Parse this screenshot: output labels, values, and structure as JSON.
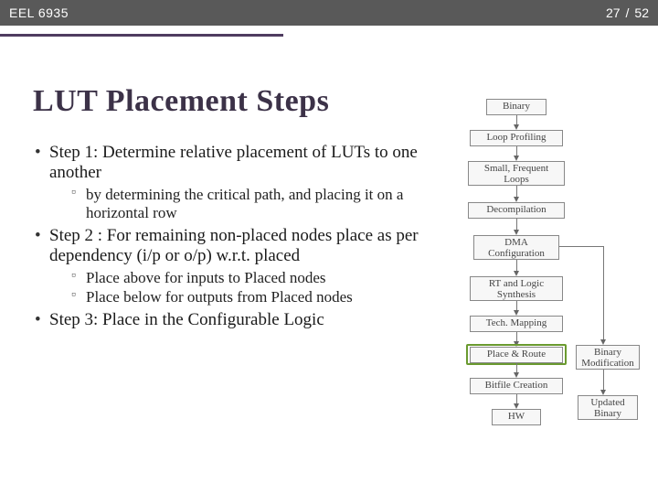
{
  "header": {
    "course": "EEL 6935",
    "page_current": "27",
    "page_sep": "/",
    "page_total": "52"
  },
  "title": "LUT Placement Steps",
  "bullets": [
    {
      "text": "Step 1: Determine relative placement of LUTs to one another",
      "sub": [
        "by determining the critical path, and placing it on a horizontal row"
      ]
    },
    {
      "text": "Step 2 : For remaining non-placed nodes place as per dependency (i/p or o/p) w.r.t. placed",
      "sub": [
        "Place  above for inputs to Placed nodes",
        "Place below for outputs from Placed nodes"
      ]
    },
    {
      "text": "Step 3: Place in the Configurable Logic",
      "sub": []
    }
  ],
  "flow": {
    "n1": "Binary",
    "n2": "Loop Profiling",
    "n3": "Small, Frequent Loops",
    "n4": "Decompilation",
    "n5": "DMA Configuration",
    "n6": "RT and Logic Synthesis",
    "n7": "Tech. Mapping",
    "n8": "Place & Route",
    "n9": "Bitfile Creation",
    "n10": "HW",
    "n11": "Binary Modification",
    "n12": "Updated Binary"
  }
}
